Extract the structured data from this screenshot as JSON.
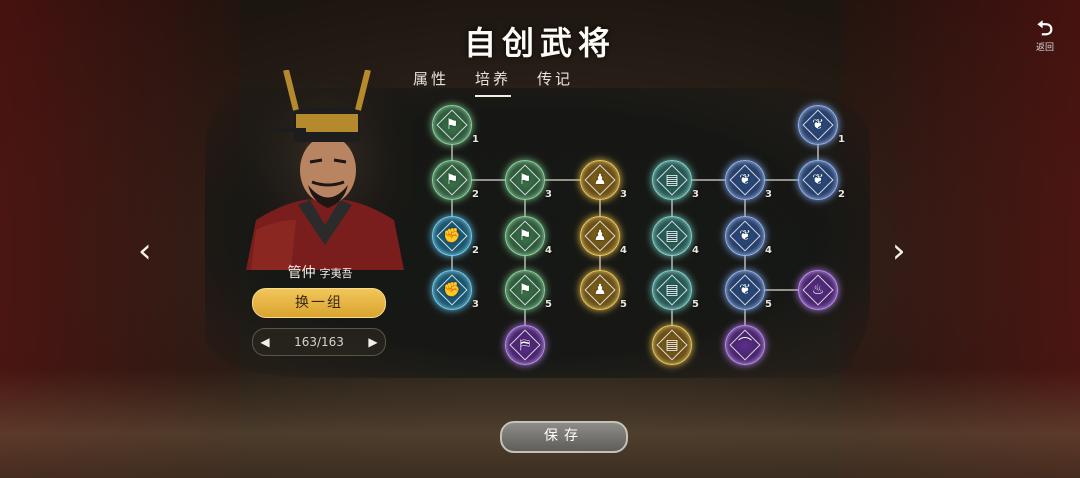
{
  "header": {
    "title": "自创武将"
  },
  "tabs": [
    {
      "label": "属性",
      "active": false
    },
    {
      "label": "培养",
      "active": true
    },
    {
      "label": "传记",
      "active": false
    }
  ],
  "back": {
    "icon": "return-arrow-icon",
    "label": "返回"
  },
  "hero": {
    "name": "管仲",
    "courtesy": "字夷吾"
  },
  "reroll": {
    "label": "换一组"
  },
  "pager": {
    "text": "163/163"
  },
  "save": {
    "label": "保存"
  },
  "colors": {
    "green": "#8fd39f",
    "teal": "#86d6cc",
    "gold": "#eecb5a",
    "blue": "#93b4ee",
    "cyan": "#72cff2",
    "purple": "#b98ef0",
    "button_gold": "#e2b040"
  },
  "skill_tree": {
    "nodes": [
      {
        "id": "n1",
        "color": "green",
        "icon": "flag-icon",
        "level": "1"
      },
      {
        "id": "n2",
        "color": "green",
        "icon": "flag-icon",
        "level": "2"
      },
      {
        "id": "n3",
        "color": "cyan",
        "icon": "fist-icon",
        "level": "2"
      },
      {
        "id": "n4",
        "color": "cyan",
        "icon": "fist-icon",
        "level": "3"
      },
      {
        "id": "n5",
        "color": "green",
        "icon": "flag-icon",
        "level": "3"
      },
      {
        "id": "n6",
        "color": "green",
        "icon": "flag-icon",
        "level": "4"
      },
      {
        "id": "n7",
        "color": "green",
        "icon": "flag-icon",
        "level": "5"
      },
      {
        "id": "n8",
        "color": "purple",
        "icon": "banner-icon",
        "level": ""
      },
      {
        "id": "n9",
        "color": "gold",
        "icon": "person-icon",
        "level": "3"
      },
      {
        "id": "n10",
        "color": "gold",
        "icon": "person-icon",
        "level": "4"
      },
      {
        "id": "n11",
        "color": "gold",
        "icon": "person-icon",
        "level": "5"
      },
      {
        "id": "n12",
        "color": "teal",
        "icon": "book-icon",
        "level": "3"
      },
      {
        "id": "n13",
        "color": "teal",
        "icon": "book-icon",
        "level": "4"
      },
      {
        "id": "n14",
        "color": "teal",
        "icon": "book-icon",
        "level": "5"
      },
      {
        "id": "n15",
        "color": "gold",
        "icon": "book-icon",
        "level": ""
      },
      {
        "id": "n16",
        "color": "blue",
        "icon": "feather-icon",
        "level": "3"
      },
      {
        "id": "n17",
        "color": "blue",
        "icon": "feather-icon",
        "level": "4"
      },
      {
        "id": "n18",
        "color": "blue",
        "icon": "feather-icon",
        "level": "5"
      },
      {
        "id": "n19",
        "color": "purple",
        "icon": "boot-icon",
        "level": ""
      },
      {
        "id": "n20",
        "color": "blue",
        "icon": "feather-icon",
        "level": "1"
      },
      {
        "id": "n21",
        "color": "blue",
        "icon": "feather-icon",
        "level": "2"
      },
      {
        "id": "n22",
        "color": "purple",
        "icon": "fire-icon",
        "level": ""
      }
    ]
  }
}
